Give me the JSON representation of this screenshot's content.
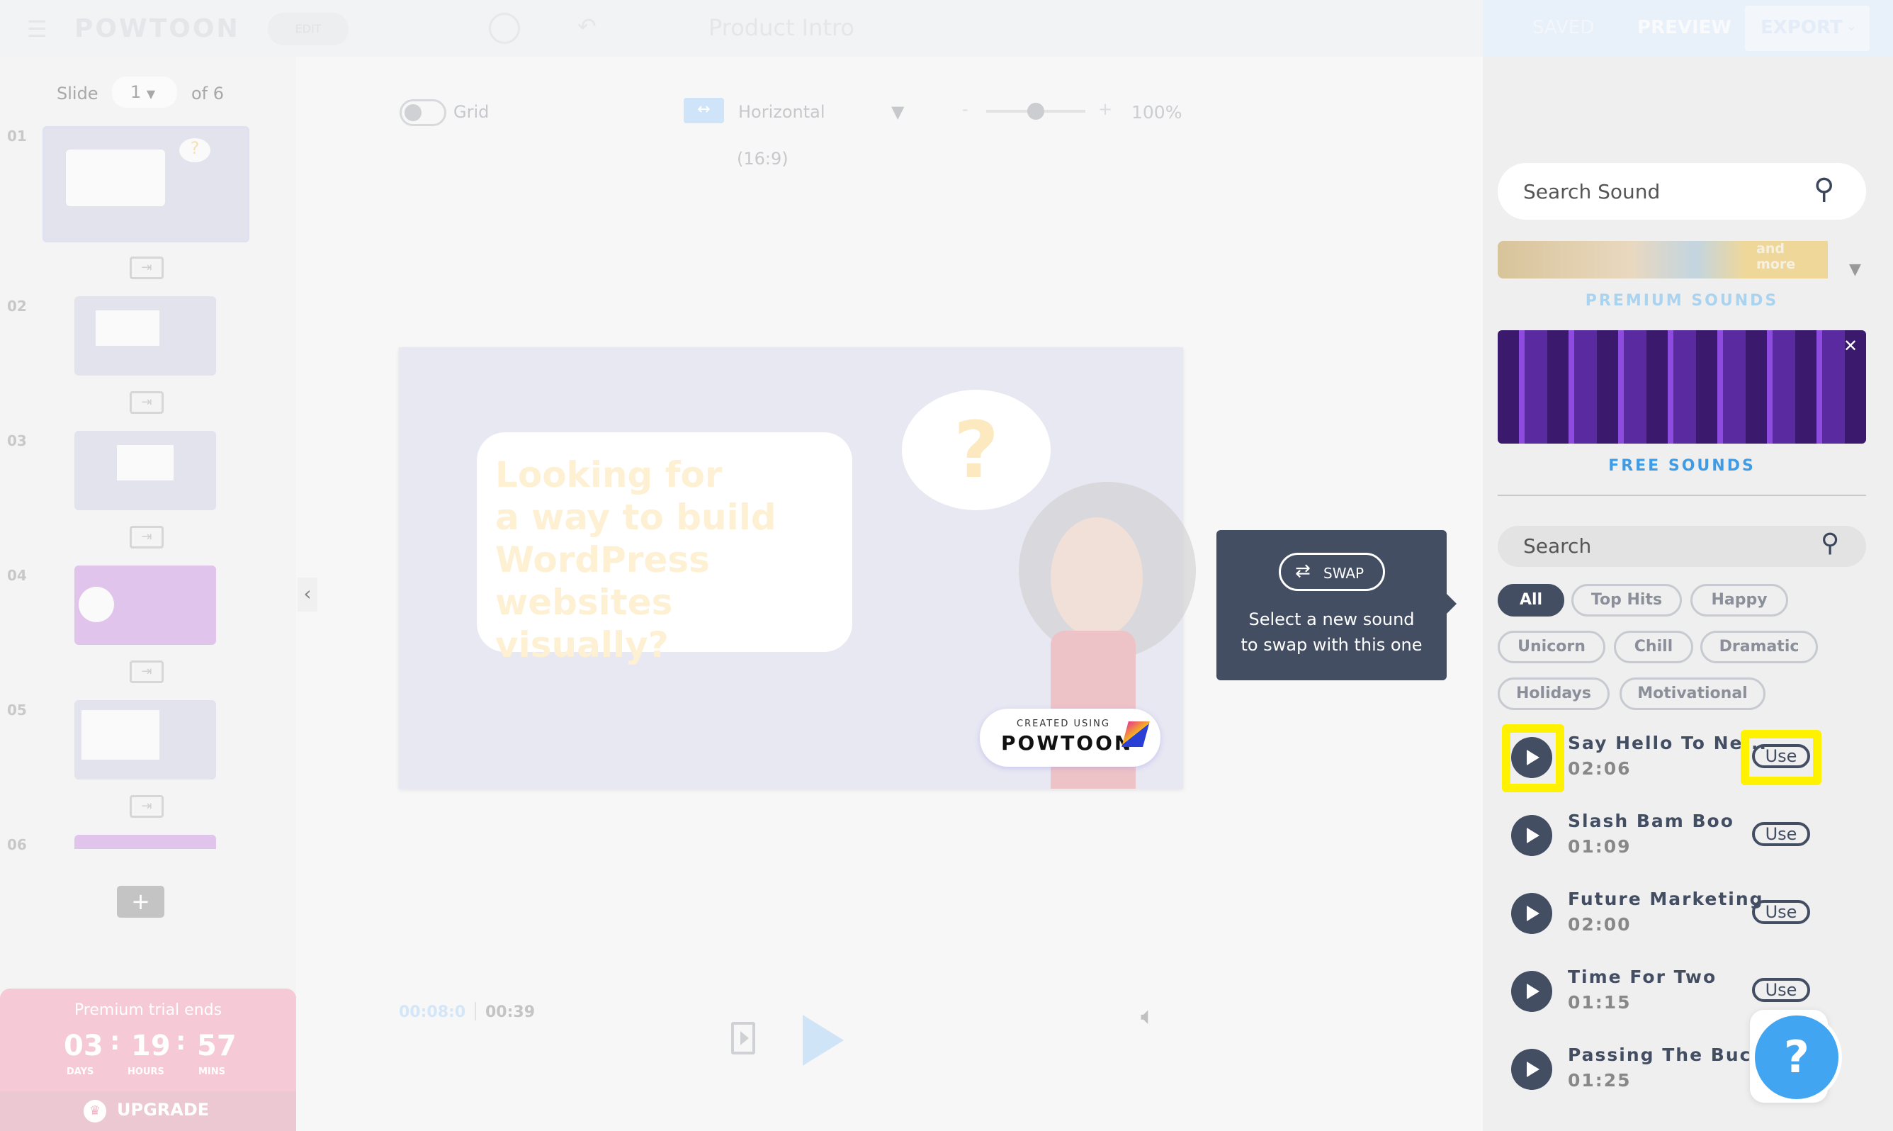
{
  "topbar": {
    "logo": "POWTOON",
    "edit_label": "EDIT",
    "project_title": "Product Intro",
    "saved_label": "SAVED",
    "preview_label": "PREVIEW",
    "export_label": "EXPORT"
  },
  "slides": {
    "label": "Slide",
    "current": "1",
    "of_label": "of 6",
    "numbers": [
      "01",
      "02",
      "03",
      "04",
      "05",
      "06"
    ]
  },
  "toolbar": {
    "grid_label": "Grid",
    "orientation": "Horizontal",
    "ratio": "(16:9)",
    "zoom_minus": "-",
    "zoom_plus": "+",
    "zoom": "100%",
    "zoom_level": 0.5
  },
  "canvas": {
    "headline_lines": [
      "Looking for",
      "a way to build",
      "WordPress",
      "websites visually?"
    ],
    "bubble": "?",
    "badge_small": "CREATED USING",
    "badge_brand": "POWTOON"
  },
  "playback": {
    "current_time": "00:08:0",
    "total_time": "00:39"
  },
  "tooltip": {
    "swap_label": "SWAP",
    "line1": "Select a new sound",
    "line2": "to swap with this one"
  },
  "trial": {
    "title": "Premium trial ends",
    "days": "03",
    "hours": "19",
    "mins": "57",
    "days_label": "DAYS",
    "hours_label": "HOURS",
    "mins_label": "MINS",
    "sep": ":",
    "upgrade": "UPGRADE"
  },
  "sounds": {
    "search_placeholder": "Search Sound",
    "banner_text": "and more",
    "premium_label": "PREMIUM SOUNDS",
    "free_label": "FREE SOUNDS",
    "search2_placeholder": "Search",
    "tags": [
      "All",
      "Top Hits",
      "Happy",
      "Unicorn",
      "Chill",
      "Dramatic",
      "Holidays",
      "Motivational"
    ],
    "use_label": "Use",
    "items": [
      {
        "title": "Say Hello To Ne...",
        "duration": "02:06"
      },
      {
        "title": "Slash Bam Boo",
        "duration": "01:09"
      },
      {
        "title": "Future Marketing",
        "duration": "02:00"
      },
      {
        "title": "Time For Two",
        "duration": "01:15"
      },
      {
        "title": "Passing The Buck",
        "duration": "01:25"
      }
    ]
  },
  "help": {
    "icon_text": "?"
  }
}
